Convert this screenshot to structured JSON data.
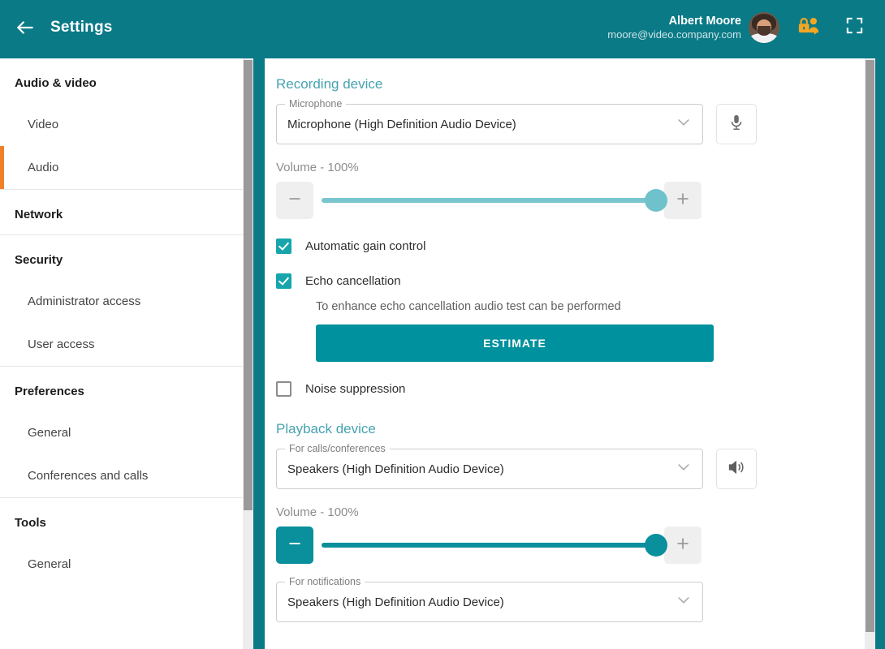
{
  "header": {
    "back_icon": "arrow-left-icon",
    "title": "Settings",
    "user_name": "Albert Moore",
    "user_email": "moore@video.company.com",
    "avatar_icon": "user-avatar",
    "secure_user_icon": "lock-user-icon",
    "fullscreen_icon": "fullscreen-icon",
    "accent_color": "#0a7a87",
    "secure_icon_color": "#f5a623"
  },
  "sidebar": {
    "active_indicator_color": "#f0802a",
    "groups": [
      {
        "title": "Audio & video",
        "items": [
          {
            "label": "Video",
            "active": false
          },
          {
            "label": "Audio",
            "active": true
          }
        ]
      },
      {
        "title": "Network",
        "items": []
      },
      {
        "title": "Security",
        "items": [
          {
            "label": "Administrator access",
            "active": false
          },
          {
            "label": "User access",
            "active": false
          }
        ]
      },
      {
        "title": "Preferences",
        "items": [
          {
            "label": "General",
            "active": false
          },
          {
            "label": "Conferences and calls",
            "active": false
          }
        ]
      },
      {
        "title": "Tools",
        "items": [
          {
            "label": "General",
            "active": false
          }
        ]
      }
    ]
  },
  "main": {
    "recording": {
      "section_title": "Recording device",
      "mic_legend": "Microphone",
      "mic_value": "Microphone (High Definition Audio Device)",
      "mic_test_icon": "microphone-icon",
      "volume_label": "Volume - 100%",
      "volume_percent": 100,
      "decrease_icon": "minus-icon",
      "increase_icon": "plus-icon",
      "checkboxes": [
        {
          "label": "Automatic gain control",
          "checked": true
        },
        {
          "label": "Echo cancellation",
          "checked": true
        }
      ],
      "echo_hint": "To enhance echo cancellation audio test can be performed",
      "estimate_label": "ESTIMATE",
      "noise": {
        "label": "Noise suppression",
        "checked": false
      }
    },
    "playback": {
      "section_title": "Playback device",
      "calls_legend": "For calls/conferences",
      "calls_value": "Speakers (High Definition Audio Device)",
      "speaker_test_icon": "speaker-icon",
      "volume_label": "Volume - 100%",
      "volume_percent": 100,
      "decrease_icon": "minus-icon",
      "increase_icon": "plus-icon",
      "notifications_legend": "For notifications",
      "notifications_value": "Speakers (High Definition Audio Device)"
    },
    "chevron_icon": "chevron-down-icon"
  }
}
